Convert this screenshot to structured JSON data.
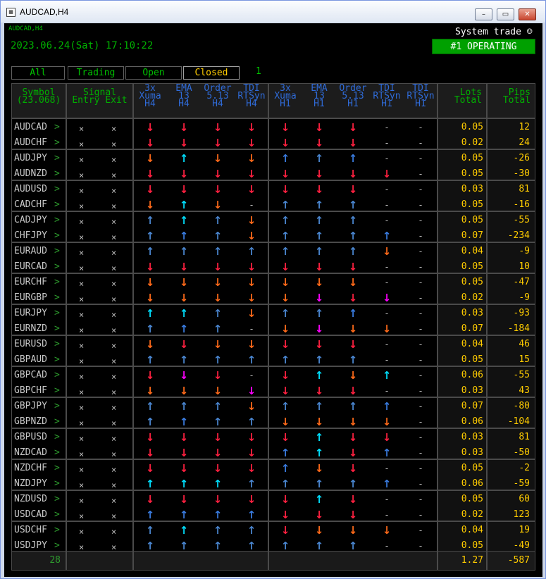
{
  "window": {
    "title": "AUDCAD,H4",
    "icon": "chart-window-icon"
  },
  "indicator": {
    "small_label": "AUDCAD,H4",
    "datetime": "2023.06.24(Sat) 17:10:22",
    "system_trade": "System trade ☺",
    "operating_label": "#1 OPERATING"
  },
  "tabs": [
    {
      "label": "All"
    },
    {
      "label": "Trading"
    },
    {
      "label": "Open"
    },
    {
      "label": "Closed",
      "active": true
    }
  ],
  "tab_count": "1",
  "headers": {
    "symbol": [
      "Symbol",
      "(23.068)"
    ],
    "signal": [
      "Signal",
      "Entry Exit"
    ],
    "h4": [
      [
        "3x",
        "Xuma",
        "H4"
      ],
      [
        "EMA",
        "13",
        "H4"
      ],
      [
        "Order",
        "5.13",
        "H4"
      ],
      [
        "TDI",
        "RTSyn",
        "H4"
      ]
    ],
    "h1": [
      [
        "3x",
        "Xuma",
        "H1"
      ],
      [
        "EMA",
        "13",
        "H1"
      ],
      [
        "Order",
        "5.13",
        "H1"
      ],
      [
        "TDI",
        "RTSyn",
        "H1"
      ],
      [
        "TDI",
        "RTSyn",
        "H1"
      ]
    ],
    "lots": [
      "Lots",
      "Total"
    ],
    "pips": [
      "Pips",
      "Total"
    ]
  },
  "colors": {
    "red": "#ff2040",
    "orange": "#ff6a1a",
    "blue": "#3a7ce0",
    "cyan": "#00e0ff",
    "magenta": "#ff00ff",
    "steel": "#4a86d0"
  },
  "rows": [
    {
      "symbol": "AUDCAD",
      "entry": "×",
      "exit": "×",
      "signals": [
        "dr",
        "dr",
        "dr",
        "dr",
        "dr",
        "dr",
        "dr",
        "-",
        "-"
      ],
      "lots": "0.05",
      "pips": "12"
    },
    {
      "symbol": "AUDCHF",
      "entry": "×",
      "exit": "×",
      "signals": [
        "dr",
        "dr",
        "dr",
        "dr",
        "dr",
        "dr",
        "dr",
        "-",
        "-"
      ],
      "lots": "0.02",
      "pips": "24"
    },
    {
      "symbol": "AUDJPY",
      "entry": "×",
      "exit": "×",
      "signals": [
        "do",
        "uc",
        "do",
        "do",
        "ub",
        "us",
        "ub",
        "-",
        "-"
      ],
      "lots": "0.05",
      "pips": "-26"
    },
    {
      "symbol": "AUDNZD",
      "entry": "×",
      "exit": "×",
      "signals": [
        "dr",
        "dr",
        "dr",
        "dr",
        "dr",
        "dr",
        "dr",
        "dr",
        "-"
      ],
      "lots": "0.05",
      "pips": "-30"
    },
    {
      "symbol": "AUDUSD",
      "entry": "×",
      "exit": "×",
      "signals": [
        "dr",
        "dr",
        "dr",
        "dr",
        "dr",
        "dr",
        "dr",
        "-",
        "-"
      ],
      "lots": "0.03",
      "pips": "81"
    },
    {
      "symbol": "CADCHF",
      "entry": "×",
      "exit": "×",
      "signals": [
        "do",
        "uc",
        "do",
        "-",
        "us",
        "us",
        "us",
        "-",
        "-"
      ],
      "lots": "0.05",
      "pips": "-16"
    },
    {
      "symbol": "CADJPY",
      "entry": "×",
      "exit": "×",
      "signals": [
        "us",
        "uc",
        "us",
        "do",
        "us",
        "us",
        "us",
        "-",
        "-"
      ],
      "lots": "0.05",
      "pips": "-55"
    },
    {
      "symbol": "CHFJPY",
      "entry": "×",
      "exit": "×",
      "signals": [
        "us",
        "ub",
        "us",
        "do",
        "us",
        "us",
        "us",
        "ub",
        "-"
      ],
      "lots": "0.07",
      "pips": "-234"
    },
    {
      "symbol": "EURAUD",
      "entry": "×",
      "exit": "×",
      "signals": [
        "us",
        "us",
        "us",
        "us",
        "us",
        "us",
        "us",
        "do",
        "-"
      ],
      "lots": "0.04",
      "pips": "-9"
    },
    {
      "symbol": "EURCAD",
      "entry": "×",
      "exit": "×",
      "signals": [
        "dr",
        "dr",
        "dr",
        "dr",
        "dr",
        "dr",
        "dr",
        "-",
        "-"
      ],
      "lots": "0.05",
      "pips": "10"
    },
    {
      "symbol": "EURCHF",
      "entry": "×",
      "exit": "×",
      "signals": [
        "do",
        "do",
        "do",
        "do",
        "do",
        "do",
        "do",
        "-",
        "-"
      ],
      "lots": "0.05",
      "pips": "-47"
    },
    {
      "symbol": "EURGBP",
      "entry": "×",
      "exit": "×",
      "signals": [
        "do",
        "do",
        "do",
        "do",
        "do",
        "dm",
        "dr",
        "dm",
        "-"
      ],
      "lots": "0.02",
      "pips": "-9"
    },
    {
      "symbol": "EURJPY",
      "entry": "×",
      "exit": "×",
      "signals": [
        "uc",
        "uc",
        "us",
        "do",
        "us",
        "us",
        "ub",
        "-",
        "-"
      ],
      "lots": "0.03",
      "pips": "-93"
    },
    {
      "symbol": "EURNZD",
      "entry": "×",
      "exit": "×",
      "signals": [
        "us",
        "ub",
        "us",
        "-",
        "do",
        "dm",
        "do",
        "do",
        "-"
      ],
      "lots": "0.07",
      "pips": "-184"
    },
    {
      "symbol": "EURUSD",
      "entry": "×",
      "exit": "×",
      "signals": [
        "do",
        "dr",
        "do",
        "do",
        "dr",
        "dr",
        "dr",
        "-",
        "-"
      ],
      "lots": "0.04",
      "pips": "46"
    },
    {
      "symbol": "GBPAUD",
      "entry": "×",
      "exit": "×",
      "signals": [
        "us",
        "us",
        "us",
        "us",
        "us",
        "us",
        "us",
        "-",
        "-"
      ],
      "lots": "0.05",
      "pips": "15"
    },
    {
      "symbol": "GBPCAD",
      "entry": "×",
      "exit": "×",
      "signals": [
        "dr",
        "dm",
        "dr",
        "-",
        "dr",
        "uc",
        "do",
        "uc",
        "-"
      ],
      "lots": "0.06",
      "pips": "-55"
    },
    {
      "symbol": "GBPCHF",
      "entry": "×",
      "exit": "×",
      "signals": [
        "do",
        "do",
        "do",
        "dm",
        "dr",
        "dr",
        "dr",
        "-",
        "-"
      ],
      "lots": "0.03",
      "pips": "43"
    },
    {
      "symbol": "GBPJPY",
      "entry": "×",
      "exit": "×",
      "signals": [
        "us",
        "us",
        "us",
        "do",
        "us",
        "us",
        "us",
        "ub",
        "-"
      ],
      "lots": "0.07",
      "pips": "-80"
    },
    {
      "symbol": "GBPNZD",
      "entry": "×",
      "exit": "×",
      "signals": [
        "us",
        "ub",
        "us",
        "us",
        "do",
        "do",
        "do",
        "do",
        "-"
      ],
      "lots": "0.06",
      "pips": "-104"
    },
    {
      "symbol": "GBPUSD",
      "entry": "×",
      "exit": "×",
      "signals": [
        "dr",
        "dr",
        "dr",
        "dr",
        "dr",
        "uc",
        "dr",
        "dr",
        "-"
      ],
      "lots": "0.03",
      "pips": "81"
    },
    {
      "symbol": "NZDCAD",
      "entry": "×",
      "exit": "×",
      "signals": [
        "dr",
        "dr",
        "dr",
        "dr",
        "ub",
        "uc",
        "dr",
        "ub",
        "-"
      ],
      "lots": "0.03",
      "pips": "-50"
    },
    {
      "symbol": "NZDCHF",
      "entry": "×",
      "exit": "×",
      "signals": [
        "dr",
        "dr",
        "dr",
        "dr",
        "ub",
        "do",
        "dr",
        "-",
        "-"
      ],
      "lots": "0.05",
      "pips": "-2"
    },
    {
      "symbol": "NZDJPY",
      "entry": "×",
      "exit": "×",
      "signals": [
        "uc",
        "uc",
        "uc",
        "us",
        "us",
        "us",
        "us",
        "ub",
        "-"
      ],
      "lots": "0.06",
      "pips": "-59"
    },
    {
      "symbol": "NZDUSD",
      "entry": "×",
      "exit": "×",
      "signals": [
        "dr",
        "dr",
        "dr",
        "dr",
        "dr",
        "uc",
        "dr",
        "-",
        "-"
      ],
      "lots": "0.05",
      "pips": "60"
    },
    {
      "symbol": "USDCAD",
      "entry": "×",
      "exit": "×",
      "signals": [
        "ub",
        "ub",
        "ub",
        "ub",
        "dr",
        "dr",
        "dr",
        "-",
        "-"
      ],
      "lots": "0.02",
      "pips": "123"
    },
    {
      "symbol": "USDCHF",
      "entry": "×",
      "exit": "×",
      "signals": [
        "us",
        "uc",
        "us",
        "us",
        "dr",
        "do",
        "do",
        "do",
        "-"
      ],
      "lots": "0.04",
      "pips": "19"
    },
    {
      "symbol": "USDJPY",
      "entry": "×",
      "exit": "×",
      "signals": [
        "us",
        "us",
        "us",
        "us",
        "us",
        "us",
        "us",
        "-",
        "-"
      ],
      "lots": "0.05",
      "pips": "-49"
    }
  ],
  "footer": {
    "count": "28",
    "lots_total": "1.27",
    "pips_total": "-587"
  }
}
